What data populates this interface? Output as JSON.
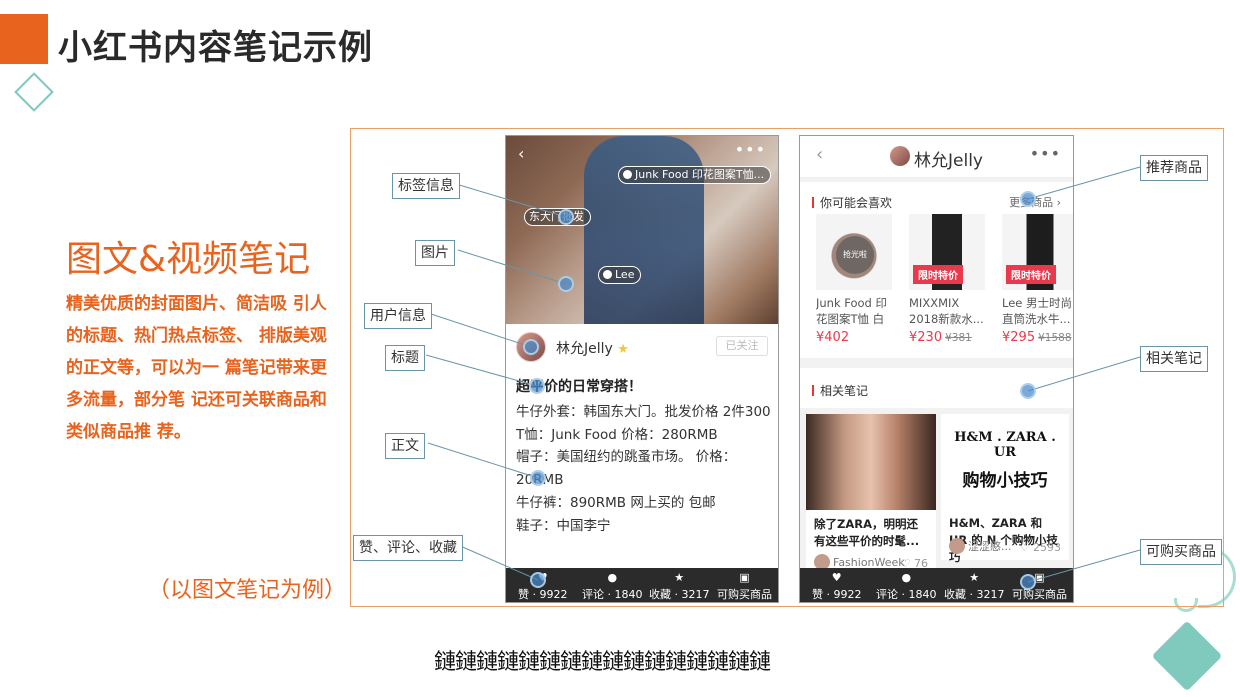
{
  "slide": {
    "title": "小红书内容笔记示例",
    "heading": "图文&视频笔记",
    "description": "精美优质的封面图片、简洁吸 引人的标题、热门热点标签、 排版美观的正文等，可以为一 篇笔记带来更多流量，部分笔 记还可关联商品和类似商品推 荐。",
    "caption": "（以图文笔记为例）",
    "footer_text": "鏈鏈鏈鏈鏈鏈鏈鏈鏈鏈鏈鏈鏈鏈鏈鏈"
  },
  "callouts": {
    "tag_info": "标签信息",
    "image": "图片",
    "user_info": "用户信息",
    "title": "标题",
    "body": "正文",
    "actions": "赞、评论、收藏",
    "recommended": "推荐商品",
    "related_notes": "相关笔记",
    "buyable": "可购买商品"
  },
  "phone1": {
    "back_icon": "‹",
    "more_icon": "•••",
    "tags": [
      {
        "label": "Junk Food 印花图案T恤..."
      },
      {
        "label": "东大门批发"
      },
      {
        "label": "Lee"
      }
    ],
    "user": {
      "name": "林允Jelly",
      "verified_icon": "★",
      "follow_label": "已关注"
    },
    "note_title": "超平价的日常穿搭！",
    "body_lines": [
      "牛仔外套：韩国东大门。批发价格 2件300",
      "T恤：Junk Food  价格：280RMB",
      "帽子：美国纽约的跳蚤市场。 价格：20RMB",
      "牛仔裤：890RMB  网上买的 包邮",
      "鞋子：中国李宁"
    ]
  },
  "phone2": {
    "back_icon": "‹",
    "user_name": "林允Jelly",
    "more_icon": "•••",
    "may_like_title": "你可能会喜欢",
    "more_products": "更多商品 ›",
    "products": [
      {
        "name": "Junk Food 印花图案T恤 白",
        "price": "¥402",
        "old_price": "",
        "badge": "",
        "overlay": "抢光啦"
      },
      {
        "name": "MIXXMIX 2018新款水...",
        "price": "¥230",
        "old_price": "¥381",
        "badge": "限时特价",
        "overlay": ""
      },
      {
        "name": "Lee 男士时尚 直筒洗水牛...",
        "price": "¥295",
        "old_price": "¥1588",
        "badge": "限时特价",
        "overlay": ""
      }
    ],
    "related_title": "相关笔记",
    "notes": [
      {
        "title": "除了ZARA，明明还有这些平价的时髦...",
        "author": "FashionWeek",
        "likes": "♡ 76"
      },
      {
        "brand_line": "H&M . ZARA . UR",
        "big_text": "购物小技巧",
        "title": "H&M、ZARA 和 UR 的 N 个购物小技巧",
        "author": "涩涩憨...",
        "likes": "♡ 2593"
      }
    ]
  },
  "bottom_bar": {
    "like": "赞 · 9922",
    "comment": "评论 · 1840",
    "collect": "收藏 · 3217",
    "buy": "可购买商品"
  },
  "colors": {
    "accent_orange": "#e8641e",
    "teal": "#7fcabd",
    "price_red": "#e8394d",
    "marker_blue": "#4889c9"
  }
}
